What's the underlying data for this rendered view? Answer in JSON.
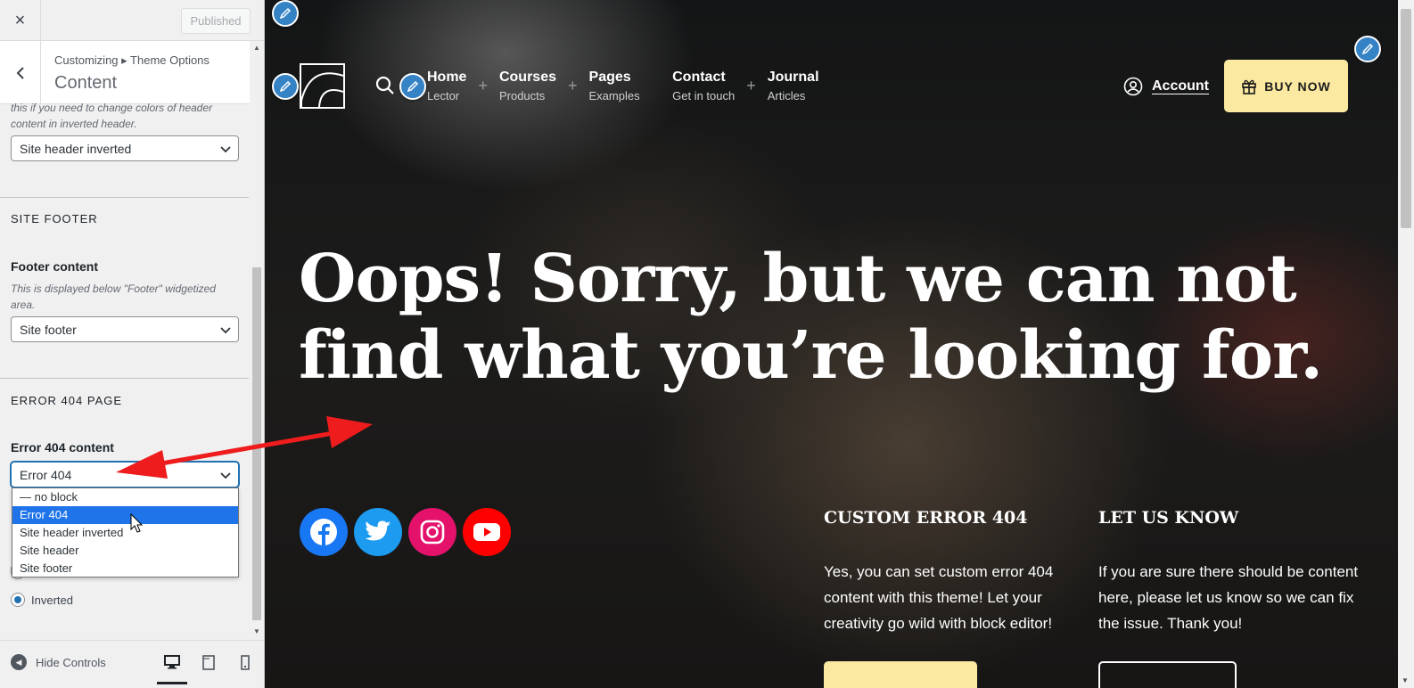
{
  "sidebar": {
    "close_label": "×",
    "published_label": "Published",
    "breadcrumb": "Customizing ▸ Theme Options",
    "panel_title": "Content",
    "header_desc_partial": "this if you need to change colors of header content in inverted header.",
    "header_select_value": "Site header inverted",
    "site_footer_section": "SITE FOOTER",
    "footer_content_label": "Footer content",
    "footer_content_desc": "This is displayed below \"Footer\" widgetized area.",
    "footer_select_value": "Site footer",
    "error_section": "ERROR 404 PAGE",
    "error_content_label": "Error 404 content",
    "error_select_value": "Error 404",
    "dropdown_options": [
      "— no block",
      "Error 404",
      "Site header inverted",
      "Site header",
      "Site footer"
    ],
    "dropdown_selected_index": 1,
    "radio_label": "Inverted",
    "hide_controls_label": "Hide Controls",
    "devices": [
      "desktop-icon",
      "tablet-icon",
      "mobile-icon"
    ]
  },
  "preview": {
    "nav": [
      {
        "main": "Home",
        "sub": "Lector"
      },
      {
        "main": "Courses",
        "sub": "Products"
      },
      {
        "main": "Pages",
        "sub": "Examples"
      },
      {
        "main": "Contact",
        "sub": "Get in touch"
      },
      {
        "main": "Journal",
        "sub": "Articles"
      }
    ],
    "account_label": "Account",
    "buy_label": "BUY NOW",
    "hero_line1": "Oops! Sorry, but we can not",
    "hero_line2": "find what you’re looking for.",
    "socials": [
      {
        "name": "facebook-icon",
        "color": "#1877f2"
      },
      {
        "name": "twitter-icon",
        "color": "#1d9bf0"
      },
      {
        "name": "instagram-icon",
        "color": "#e4126b"
      },
      {
        "name": "youtube-icon",
        "color": "#ff0000"
      }
    ],
    "col1_title": "CUSTOM ERROR 404",
    "col1_text": "Yes, you can set custom error 404 content with this theme! Let your creativity go wild with block editor!",
    "col2_title": "LET US KNOW",
    "col2_text": "If you are sure there should be content here, please let us know so we can fix the issue. Thank you!"
  },
  "colors": {
    "accent": "#2271b1",
    "buy_button": "#fbe9a1",
    "annotation_arrow": "#ee1c1c",
    "edit_pencil": "#3582c4"
  }
}
